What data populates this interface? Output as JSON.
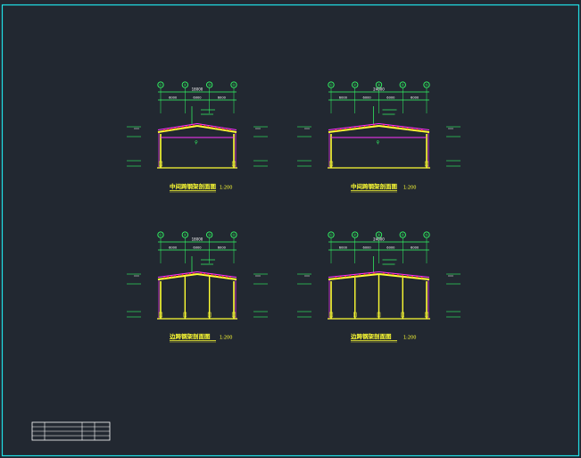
{
  "drawing": {
    "colors": {
      "background": "#222831",
      "border": "#1FE0E6",
      "structure": "#FFFF33",
      "roof": "#FF33FF",
      "annotation": "#33FF66",
      "title": "#FFFF33",
      "text": "#FFFFFF",
      "red": "#FF3333"
    },
    "sections": [
      {
        "title": "中间跨钢架剖面图",
        "scale": "1:200",
        "grid_labels": [
          "①",
          "②",
          "③",
          "④"
        ],
        "total_dim": "18000",
        "bay_dims": [
          "6000",
          "6000",
          "6000"
        ]
      },
      {
        "title": "中间跨钢架剖面图",
        "scale": "1:200",
        "grid_labels": [
          "①",
          "②",
          "③",
          "④",
          "⑤"
        ],
        "total_dim": "24000",
        "bay_dims": [
          "6000",
          "6000",
          "6000",
          "6000"
        ]
      },
      {
        "title": "边跨钢架剖面图",
        "scale": "1:200",
        "grid_labels": [
          "①",
          "②",
          "③",
          "④"
        ],
        "total_dim": "18000",
        "bay_dims": [
          "6000",
          "6000",
          "6000"
        ]
      },
      {
        "title": "边跨钢架剖面图",
        "scale": "1:200",
        "grid_labels": [
          "①",
          "②",
          "③",
          "④",
          "⑤"
        ],
        "total_dim": "24000",
        "bay_dims": [
          "6000",
          "6000",
          "6000",
          "6000"
        ]
      }
    ]
  }
}
